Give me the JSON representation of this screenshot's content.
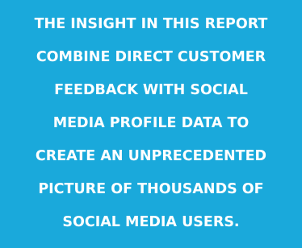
{
  "colors": {
    "background": "#1aa9db",
    "text": "#ffffff"
  },
  "statement": {
    "lines": [
      "THE INSIGHT IN THIS REPORT",
      "COMBINE DIRECT CUSTOMER",
      "FEEDBACK WITH SOCIAL",
      "MEDIA PROFILE DATA TO",
      "CREATE AN UNPRECEDENTED",
      "PICTURE OF THOUSANDS OF",
      "SOCIAL MEDIA USERS."
    ]
  }
}
